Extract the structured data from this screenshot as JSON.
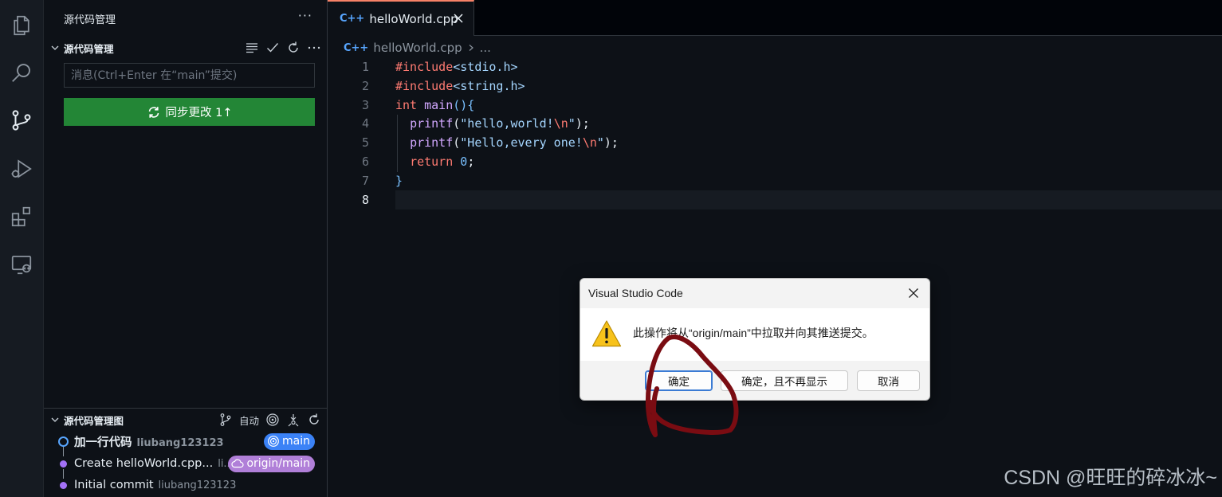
{
  "activity_bar": {
    "icons": [
      "explorer-icon",
      "search-icon",
      "source-control-icon",
      "run-debug-icon",
      "extensions-icon",
      "remote-explorer-icon"
    ]
  },
  "sidebar": {
    "title": "源代码管理",
    "more": "···",
    "scm_section": {
      "label": "源代码管理",
      "commit_placeholder": "消息(Ctrl+Enter 在“main”提交)",
      "sync_button": "同步更改 1↑"
    },
    "graph_section": {
      "label": "源代码管理图",
      "auto_label": "自动",
      "commits": [
        {
          "message": "加一行代码",
          "author": "liubang123123",
          "badge": "main"
        },
        {
          "message": "Create helloWorld.cpp...",
          "author": "li...",
          "badge": "origin/main"
        },
        {
          "message": "Initial commit",
          "author": "liubang123123",
          "badge": ""
        }
      ]
    }
  },
  "editor": {
    "tab_label": "helloWorld.cpp",
    "tab_icon": "C++",
    "breadcrumb_file": "helloWorld.cpp",
    "breadcrumb_more": "...",
    "line_numbers": [
      "1",
      "2",
      "3",
      "4",
      "5",
      "6",
      "7",
      "8"
    ]
  },
  "dialog": {
    "title": "Visual Studio Code",
    "message": "此操作将从“origin/main”中拉取并向其推送提交。",
    "buttons": {
      "ok": "确定",
      "ok_dont_show": "确定，且不再显示",
      "cancel": "取消"
    }
  },
  "watermark": "CSDN @旺旺的碎冰冰~",
  "colors": {
    "sync_button": "#238636",
    "tab_accent": "#f78166",
    "annotation": "#7a0c12"
  }
}
